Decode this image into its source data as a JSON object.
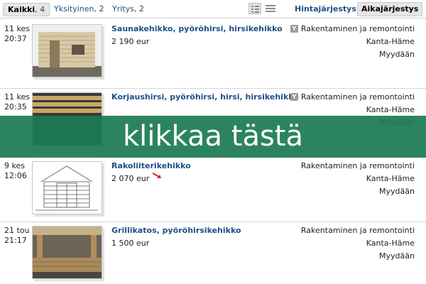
{
  "filters": {
    "all": {
      "label": "Kaikki",
      "count": ", 4"
    },
    "private": {
      "label": "Yksityinen",
      "count": ", 2"
    },
    "company": {
      "label": "Yritys",
      "count": ", 2"
    }
  },
  "sort": {
    "price_label": "Hintajärjestys",
    "time_label": "Aikajärjestys",
    "active": "time"
  },
  "view_icons": {
    "list": "list-view-icon",
    "compact": "compact-view-icon"
  },
  "listings": [
    {
      "day": "11 kes",
      "time": "20:37",
      "title": "Saunakehikko, pyöröhirsi, hirsikehikko",
      "price": "2 190 eur",
      "company_badge": "Y",
      "category": "Rakentaminen ja remontointi",
      "region": "Kanta-Häme",
      "type": "Myydään"
    },
    {
      "day": "11 kes",
      "time": "20:35",
      "title": "Korjaushirsi, pyöröhirsi, hirsi, hirsikehikko",
      "price": "",
      "company_badge": "Y",
      "category": "Rakentaminen ja remontointi",
      "region": "Kanta-Häme",
      "type": "Myydään"
    },
    {
      "day": "9 kes",
      "time": "12:06",
      "title": "Rakoliiterikehikko",
      "price": "2 070 eur",
      "company_badge": "",
      "category": "Rakentaminen ja remontointi",
      "region": "Kanta-Häme",
      "type": "Myydään"
    },
    {
      "day": "21 tou",
      "time": "21:17",
      "title": "Grillikatos, pyöröhirsikehikko",
      "price": "1 500 eur",
      "company_badge": "",
      "category": "Rakentaminen ja remontointi",
      "region": "Kanta-Häme",
      "type": "Myydään"
    }
  ],
  "overlay": {
    "text": "klikkaa tästä",
    "color": "#1c7a54"
  },
  "colors": {
    "link": "#1f4f86",
    "active_tab_bg": "#e6e6e6",
    "badge": "#9b9b9b",
    "arrow": "#d42020"
  }
}
